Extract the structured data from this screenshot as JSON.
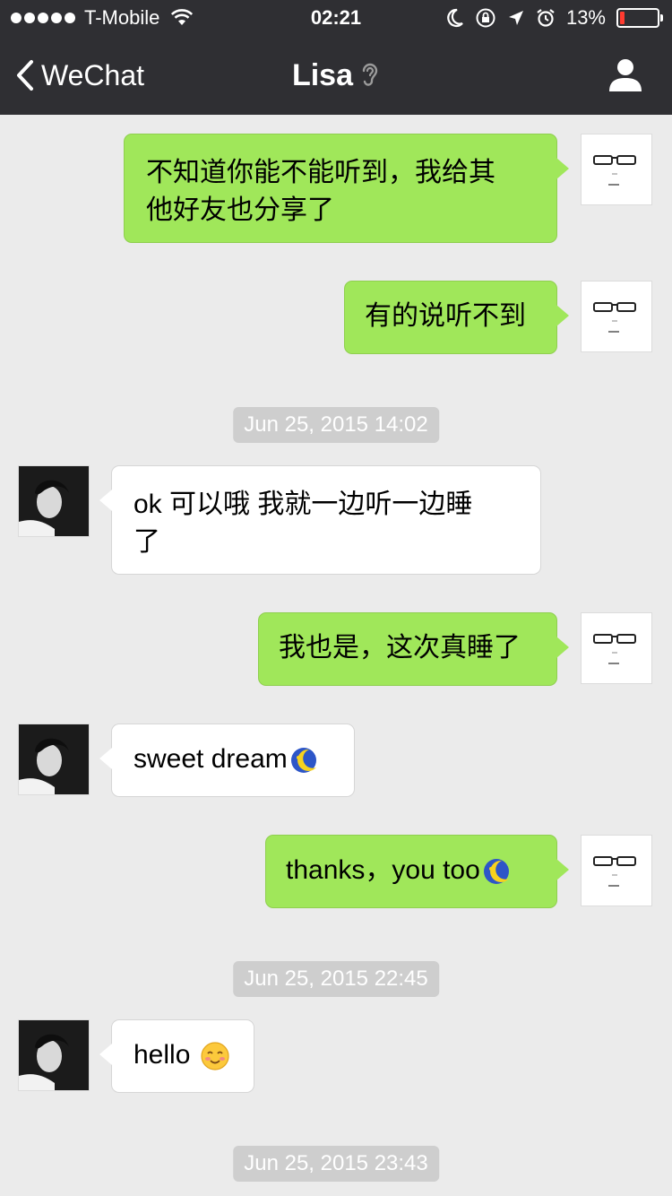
{
  "status_bar": {
    "carrier": "T-Mobile",
    "time": "02:21",
    "battery": "13%",
    "battery_level": 0.13,
    "battery_color": "#ff3b30"
  },
  "nav": {
    "back_label": "WeChat",
    "title": "Lisa",
    "icons": [
      "chevron-left-icon",
      "ear-icon",
      "profile-icon"
    ]
  },
  "colors": {
    "header_bg": "#2f2f33",
    "chat_bg": "#ebebeb",
    "my_bubble": "#a0e75a",
    "their_bubble": "#ffffff",
    "timestamp_bg": "#cecece"
  },
  "messages": [
    {
      "sender": "me",
      "text_line1": "不知道你能不能听到，我给其",
      "text_line2": "他好友也分享了"
    },
    {
      "sender": "me",
      "text": "有的说听不到"
    },
    {
      "timestamp": "Jun 25, 2015 14:02"
    },
    {
      "sender": "Lisa",
      "text_line1": "ok 可以哦 我就一边听一边睡",
      "text_line2": "了"
    },
    {
      "sender": "me",
      "text": "我也是，这次真睡了"
    },
    {
      "sender": "Lisa",
      "text": "sweet dream",
      "emoji": "sleepy-moon-emoji"
    },
    {
      "sender": "me",
      "text": "thanks，you too",
      "emoji": "sleepy-moon-emoji"
    },
    {
      "timestamp": "Jun 25, 2015 22:45"
    },
    {
      "sender": "Lisa",
      "text": "hello",
      "emoji": "blush-smile-emoji"
    },
    {
      "timestamp": "Jun 25, 2015 23:43"
    }
  ]
}
